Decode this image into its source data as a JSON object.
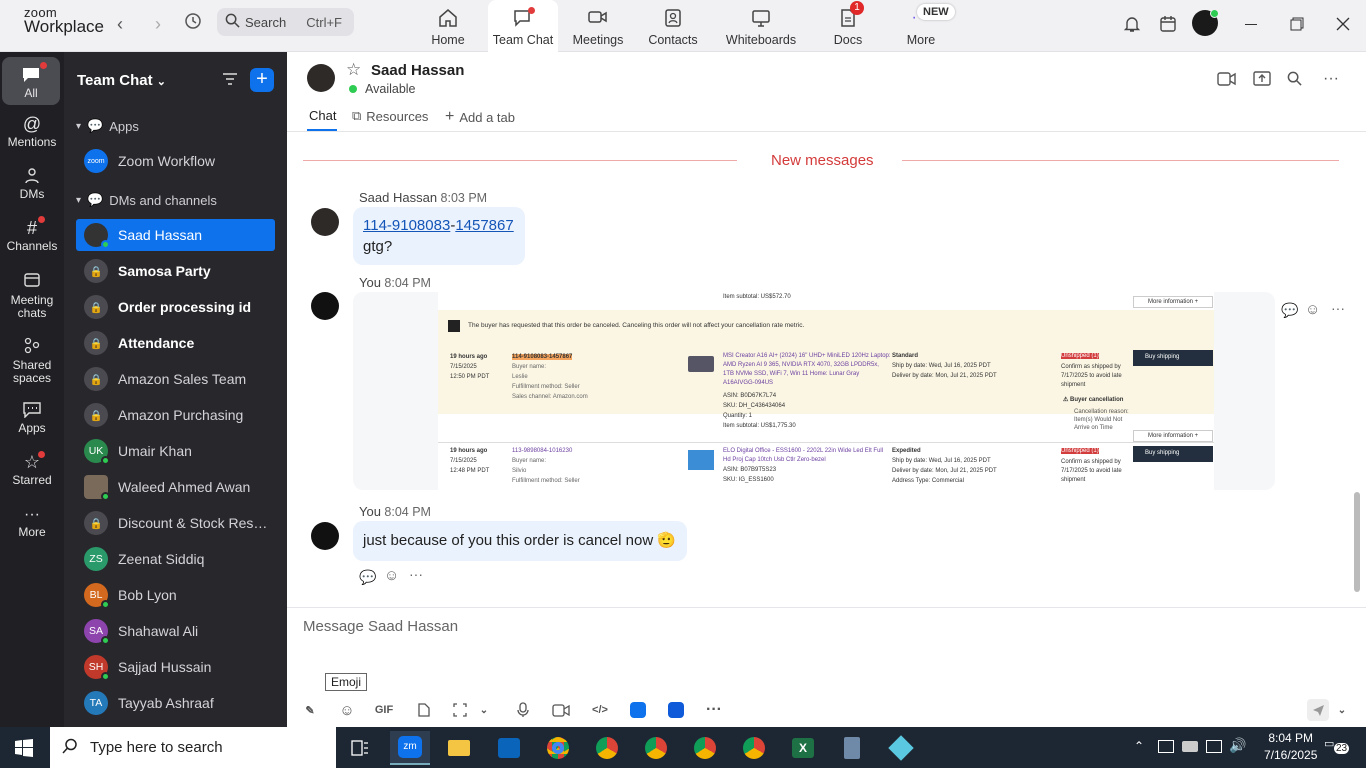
{
  "app": {
    "brand_line1": "zoom",
    "brand_line2": "Workplace"
  },
  "search": {
    "label": "Search",
    "shortcut": "Ctrl+F"
  },
  "tabs": [
    {
      "label": "Home"
    },
    {
      "label": "Team Chat"
    },
    {
      "label": "Meetings"
    },
    {
      "label": "Contacts"
    },
    {
      "label": "Whiteboards"
    },
    {
      "label": "Docs",
      "badge": "1"
    },
    {
      "label": "More",
      "badge": "NEW"
    }
  ],
  "rail": [
    {
      "label": "All"
    },
    {
      "label": "Mentions"
    },
    {
      "label": "DMs"
    },
    {
      "label": "Channels"
    },
    {
      "label": "Meeting chats"
    },
    {
      "label": "Shared spaces"
    },
    {
      "label": "Apps"
    },
    {
      "label": "Starred"
    },
    {
      "label": "More"
    }
  ],
  "sidebar": {
    "title": "Team Chat",
    "apps_section": "Apps",
    "app_item": "Zoom Workflow",
    "dm_section": "DMs and channels",
    "items": [
      {
        "name": "Saad Hassan",
        "kind": "photo",
        "selected": true
      },
      {
        "name": "Samosa Party",
        "kind": "lock",
        "bold": true
      },
      {
        "name": "Order processing id",
        "kind": "lock",
        "bold": true
      },
      {
        "name": "Attendance",
        "kind": "lock",
        "bold": true
      },
      {
        "name": "Amazon Sales Team",
        "kind": "lock"
      },
      {
        "name": "Amazon Purchasing",
        "kind": "lock"
      },
      {
        "name": "Umair Khan",
        "kind": "initials",
        "initials": "UK",
        "color": "#2a8a4e"
      },
      {
        "name": "Waleed Ahmed Awan",
        "kind": "photo2"
      },
      {
        "name": "Discount & Stock Reser...",
        "kind": "lock"
      },
      {
        "name": "Zeenat Siddiq",
        "kind": "initials",
        "initials": "ZS",
        "color": "#2a9a6a"
      },
      {
        "name": "Bob Lyon",
        "kind": "initials",
        "initials": "BL",
        "color": "#d2691e"
      },
      {
        "name": "Shahawal Ali",
        "kind": "initials",
        "initials": "SA",
        "color": "#8e44ad"
      },
      {
        "name": "Sajjad Hussain",
        "kind": "initials",
        "initials": "SH",
        "color": "#c0392b"
      },
      {
        "name": "Tayyab Ashraaf",
        "kind": "initials",
        "initials": "TA",
        "color": "#2479b8"
      }
    ]
  },
  "chat": {
    "contact_name": "Saad Hassan",
    "status": "Available",
    "tabs": [
      "Chat",
      "Resources",
      "Add a tab"
    ],
    "new_messages_label": "New messages",
    "messages": [
      {
        "sender": "Saad Hassan",
        "time": "8:03 PM",
        "link_a": "114-9108083",
        "sep": "-",
        "link_b": "1457867",
        "text2": "gtg?"
      },
      {
        "sender": "You",
        "time": "8:04 PM",
        "type": "image"
      },
      {
        "sender": "You",
        "time": "8:04 PM",
        "text": "just because of you this order is cancel now 🫡"
      }
    ],
    "composer_placeholder": "Message Saad Hassan",
    "tooltip": "Emoji",
    "gif_label": "GIF"
  },
  "screenshot_content": {
    "top_subtotal": "Item subtotal: US$572.70",
    "more_info": "More information +",
    "cancel_notice": "The buyer has requested that this order be canceled. Canceling this order will not affect your cancellation rate metric.",
    "order1": {
      "age": "19 hours ago",
      "date": "7/15/2025",
      "time": "12:50 PM PDT",
      "order_id": "114-9108083-1457867",
      "buyer": "Buyer name:",
      "buyer_name": "Leslie",
      "fulfillment": "Fulfillment method: Seller",
      "channel": "Sales channel: Amazon.com",
      "product": "MSI Creator A16 AI+ (2024) 16\" UHD+ MiniLED 120Hz Laptop: AMD Ryzen AI 9 365, NVIDIA RTX 4070, 32GB LPDDR5x, 1TB NVMe SSD, WiFi 7, Win 11 Home: Lunar Gray A16AIVGG-094US",
      "asin": "ASIN: B0D67K7L74",
      "sku": "SKU: DH_C436434064",
      "qty": "Quantity: 1",
      "subtotal": "Item subtotal: US$1,775.30",
      "shipping": "Standard",
      "ship_by": "Ship by date: Wed, Jul 16, 2025 PDT",
      "deliver_by": "Deliver by date: Mon, Jul 21, 2025 PDT",
      "status": "Unshipped (1)",
      "confirm": "Confirm as shipped by 7/17/2025 to avoid late shipment",
      "cancellation": "Buyer cancellation",
      "reason": "Cancellation reason: Item(s) Would Not Arrive on Time",
      "buy_shipping": "Buy shipping"
    },
    "order2": {
      "age": "19 hours ago",
      "date": "7/15/2025",
      "time": "12:48 PM PDT",
      "order_id": "113-9898084-1016230",
      "buyer": "Buyer name:",
      "buyer_name": "Silvio",
      "fulfillment": "Fulfillment method: Seller",
      "product": "ELO Digital Office - ESS1600 - 2202L 22in Wide Led Elt Full Hd Proj Cap 10tch Usb Ctlr Zero-bezel",
      "asin": "ASIN: B07B9T5S23",
      "sku": "SKU: IG_ESS1600",
      "shipping": "Expedited",
      "ship_by": "Ship by date: Wed, Jul 16, 2025 PDT",
      "deliver_by": "Deliver by date: Mon, Jul 21, 2025 PDT",
      "address": "Address Type: Commercial",
      "status": "Unshipped (1)",
      "confirm": "Confirm as shipped by 7/17/2025 to avoid late shipment",
      "buy_shipping": "Buy shipping"
    }
  },
  "taskbar": {
    "search_placeholder": "Type here to search",
    "time": "8:04 PM",
    "date": "7/16/2025",
    "notif_count": "23"
  }
}
